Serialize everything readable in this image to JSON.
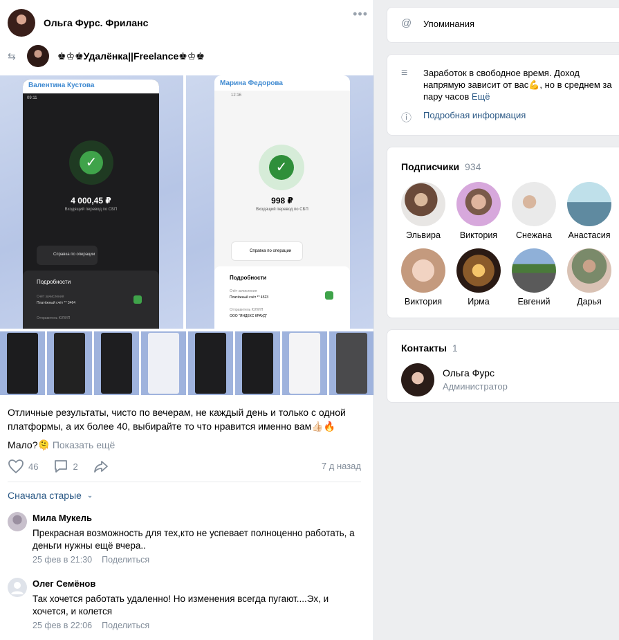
{
  "post": {
    "author": "Ольга Фурс. Фриланс",
    "repost_source": "♚♔♚Удалёнка||Freelance♚♔♚",
    "text": "Отличные результаты, чисто по вечерам, не каждый день и только с одной платформы, а их более 40, выбирайте то что нравится именно вам👍🏻🔥",
    "more_prefix": "Мало?🫠",
    "more_link": "Показать ещё",
    "likes": "46",
    "comments": "2",
    "time": "7 д назад",
    "sort_label": "Сначала старые",
    "photos": {
      "left": {
        "name": "Валентина Кустова",
        "status_time": "09:11",
        "amount": "4 000,45 ₽",
        "caption": "Входящий перевод по СБП",
        "receipt": "Справка по операции",
        "details_title": "Подробности",
        "account_label": "Счёт зачисления",
        "account_value": "Платёжный счёт ** 3464",
        "sender_label": "Отправитель ЮЛ/ИП"
      },
      "right": {
        "name": "Марина Федорова",
        "status_time": "12:16",
        "amount": "998 ₽",
        "caption": "Входящий перевод по СБП",
        "receipt": "Справка по операции",
        "details_title": "Подробности",
        "account_label": "Счёт зачисления",
        "account_value": "Платёжный счёт ** 4523",
        "sender_label": "Отправитель ЮЛ/ИП",
        "sender_value": "ООО \"ЯНДЕКС КРАУД\""
      }
    }
  },
  "comments": [
    {
      "name": "Мила Мукель",
      "text": "Прекрасная возможность для тех,кто не успевает полноценно работать, а деньги нужны ещё вчера..",
      "date": "25 фев в 21:30",
      "share": "Поделиться"
    },
    {
      "name": "Олег Семёнов",
      "text": "Так хочется работать удаленно! Но изменения всегда пугают....Эх, и хочется, и колется",
      "date": "25 фев в 22:06",
      "share": "Поделиться"
    }
  ],
  "sidebar": {
    "mentions": "Упоминания",
    "description": "Заработок в свободное время. Доход напрямую зависит от вас💪, но в среднем за пару часов",
    "description_more": "Ещё",
    "info_link": "Подробная информация",
    "subscribers_title": "Подписчики",
    "subscribers_count": "934",
    "subscribers": [
      "Эльвира",
      "Виктория",
      "Снежана",
      "Анастасия",
      "Виктория",
      "Ирма",
      "Евгений",
      "Дарья"
    ],
    "contacts_title": "Контакты",
    "contacts_count": "1",
    "contact_name": "Ольга Фурс",
    "contact_role": "Администратор"
  },
  "colors": {
    "link": "#2a5885",
    "muted": "#818c99",
    "accent_green": "#4bb34b"
  }
}
